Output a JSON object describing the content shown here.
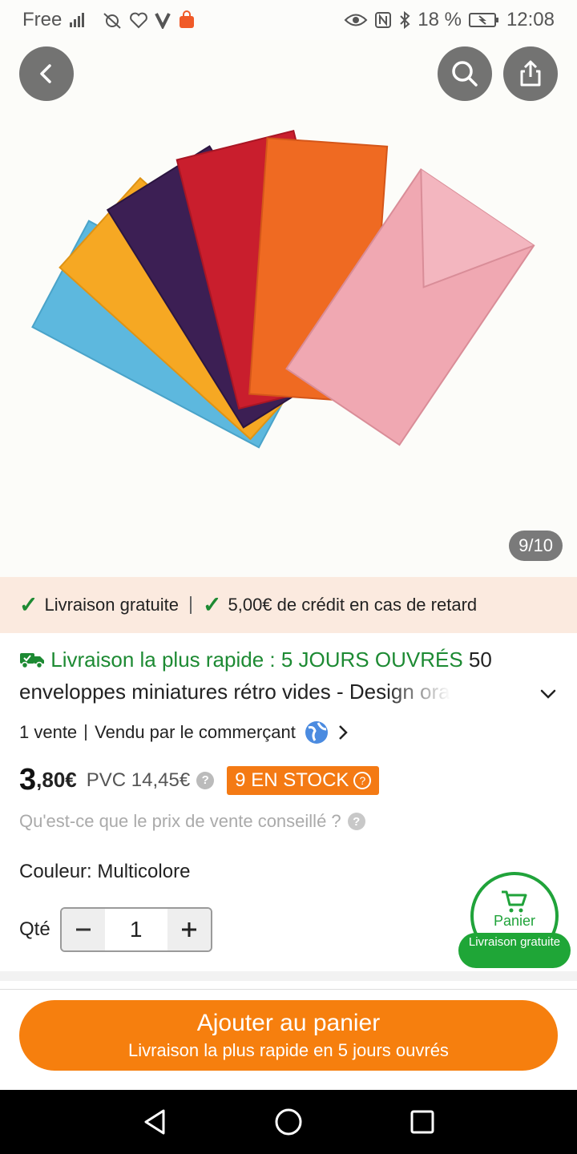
{
  "status_bar": {
    "carrier": "Free",
    "battery": "18 %",
    "time": "12:08"
  },
  "gallery": {
    "counter": "9/10"
  },
  "banner": {
    "free_shipping": "Livraison gratuite",
    "late_credit": "5,00€ de crédit en cas de retard"
  },
  "product": {
    "shipping_highlight": "Livraison la plus rapide : 5 JOURS OUVRÉS",
    "title_start": "50",
    "title_rest": "enveloppes miniatures rétro vides - Design ora",
    "sales": "1 vente",
    "sold_by": "Vendu par le commerçant",
    "price_int": "3",
    "price_cents": ",80€",
    "pvc": "PVC 14,45€",
    "stock": "9 EN STOCK",
    "rrp_question": "Qu'est-ce que le prix de vente conseillé ?",
    "color": "Couleur: Multicolore",
    "qty_label": "Qté",
    "qty_value": "1"
  },
  "cart_fab": {
    "label": "Panier",
    "pill": "Livraison gratuite"
  },
  "add_button": {
    "title": "Ajouter au panier",
    "subtitle": "Livraison la plus rapide en 5 jours ouvrés"
  },
  "colors": {
    "accent_orange": "#f67f0e",
    "green": "#1d8a33"
  }
}
